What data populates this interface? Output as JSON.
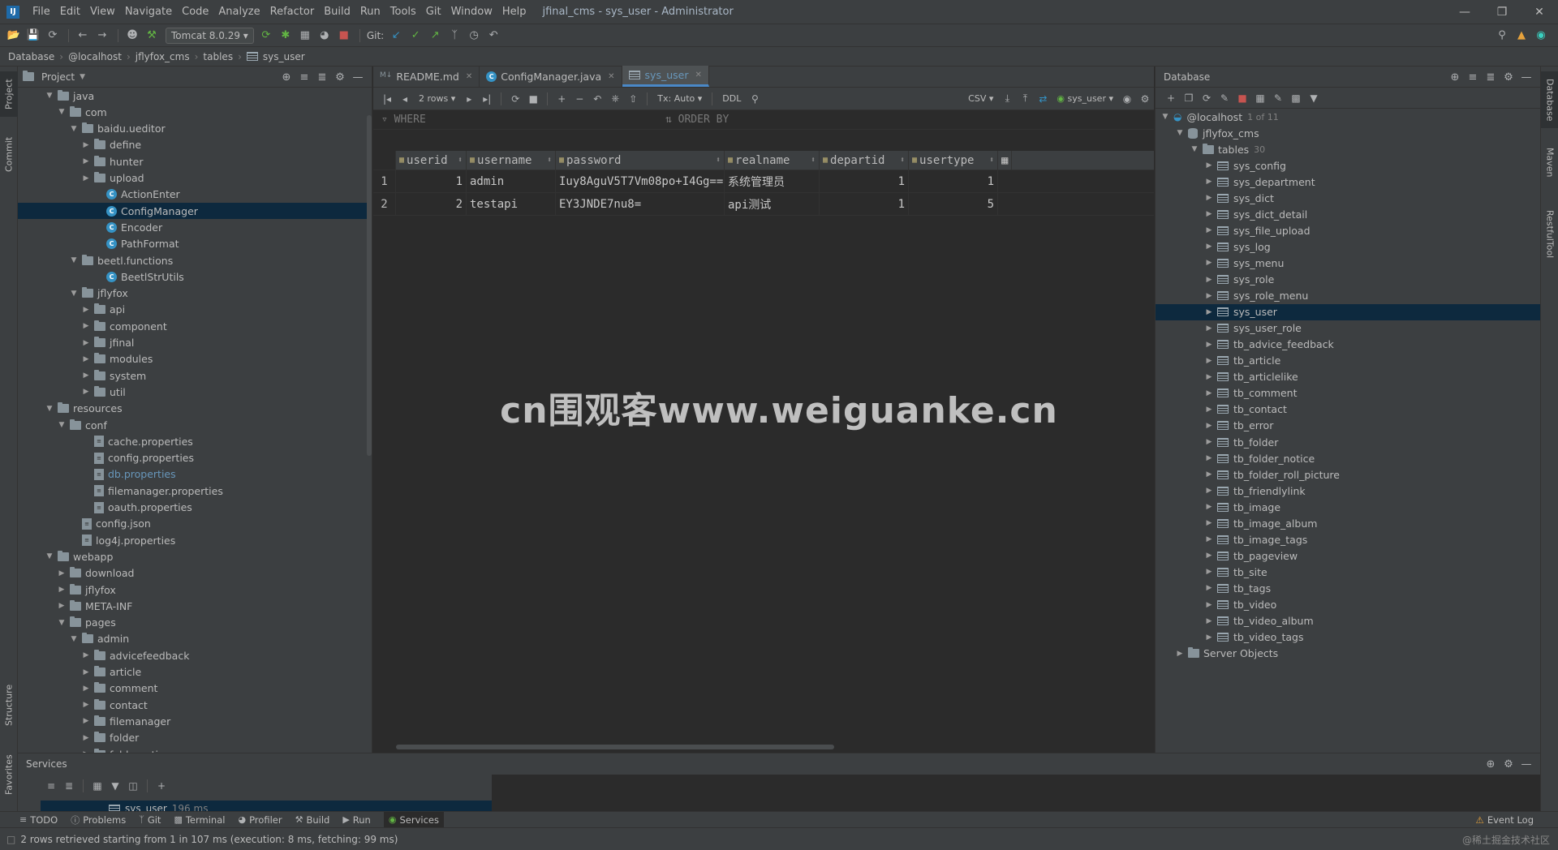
{
  "menu": [
    "File",
    "Edit",
    "View",
    "Navigate",
    "Code",
    "Analyze",
    "Refactor",
    "Build",
    "Run",
    "Tools",
    "Git",
    "Window",
    "Help"
  ],
  "window_title": "jfinal_cms - sys_user - Administrator",
  "toolbar": {
    "run_config": "Tomcat 8.0.29",
    "git_label": "Git:"
  },
  "breadcrumbs": [
    "Database",
    "@localhost",
    "jflyfox_cms",
    "tables",
    "sys_user"
  ],
  "left_strip": [
    "Project",
    "Commit",
    "Structure",
    "Favorites"
  ],
  "right_strip": [
    "Database",
    "Maven",
    "RestfulTool"
  ],
  "project": {
    "title": "Project",
    "tree": [
      {
        "label": "java",
        "depth": 3,
        "type": "folder",
        "open": true
      },
      {
        "label": "com",
        "depth": 4,
        "type": "folder",
        "open": true
      },
      {
        "label": "baidu.ueditor",
        "depth": 5,
        "type": "folder",
        "open": true
      },
      {
        "label": "define",
        "depth": 6,
        "type": "folder",
        "open": false
      },
      {
        "label": "hunter",
        "depth": 6,
        "type": "folder",
        "open": false
      },
      {
        "label": "upload",
        "depth": 6,
        "type": "folder",
        "open": false
      },
      {
        "label": "ActionEnter",
        "depth": 7,
        "type": "class"
      },
      {
        "label": "ConfigManager",
        "depth": 7,
        "type": "class",
        "selected": true
      },
      {
        "label": "Encoder",
        "depth": 7,
        "type": "class"
      },
      {
        "label": "PathFormat",
        "depth": 7,
        "type": "class"
      },
      {
        "label": "beetl.functions",
        "depth": 5,
        "type": "folder",
        "open": true
      },
      {
        "label": "BeetlStrUtils",
        "depth": 7,
        "type": "class"
      },
      {
        "label": "jflyfox",
        "depth": 5,
        "type": "folder",
        "open": true
      },
      {
        "label": "api",
        "depth": 6,
        "type": "folder",
        "open": false
      },
      {
        "label": "component",
        "depth": 6,
        "type": "folder",
        "open": false
      },
      {
        "label": "jfinal",
        "depth": 6,
        "type": "folder",
        "open": false
      },
      {
        "label": "modules",
        "depth": 6,
        "type": "folder",
        "open": false
      },
      {
        "label": "system",
        "depth": 6,
        "type": "folder",
        "open": false
      },
      {
        "label": "util",
        "depth": 6,
        "type": "folder",
        "open": false
      },
      {
        "label": "resources",
        "depth": 3,
        "type": "folder",
        "open": true
      },
      {
        "label": "conf",
        "depth": 4,
        "type": "folder",
        "open": true
      },
      {
        "label": "cache.properties",
        "depth": 6,
        "type": "prop"
      },
      {
        "label": "config.properties",
        "depth": 6,
        "type": "prop"
      },
      {
        "label": "db.properties",
        "depth": 6,
        "type": "prop",
        "blue": true
      },
      {
        "label": "filemanager.properties",
        "depth": 6,
        "type": "prop"
      },
      {
        "label": "oauth.properties",
        "depth": 6,
        "type": "prop"
      },
      {
        "label": "config.json",
        "depth": 5,
        "type": "prop"
      },
      {
        "label": "log4j.properties",
        "depth": 5,
        "type": "prop"
      },
      {
        "label": "webapp",
        "depth": 3,
        "type": "folder",
        "open": true
      },
      {
        "label": "download",
        "depth": 4,
        "type": "folder",
        "open": false
      },
      {
        "label": "jflyfox",
        "depth": 4,
        "type": "folder",
        "open": false
      },
      {
        "label": "META-INF",
        "depth": 4,
        "type": "folder",
        "open": false
      },
      {
        "label": "pages",
        "depth": 4,
        "type": "folder",
        "open": true
      },
      {
        "label": "admin",
        "depth": 5,
        "type": "folder",
        "open": true
      },
      {
        "label": "advicefeedback",
        "depth": 6,
        "type": "folder",
        "open": false
      },
      {
        "label": "article",
        "depth": 6,
        "type": "folder",
        "open": false
      },
      {
        "label": "comment",
        "depth": 6,
        "type": "folder",
        "open": false
      },
      {
        "label": "contact",
        "depth": 6,
        "type": "folder",
        "open": false
      },
      {
        "label": "filemanager",
        "depth": 6,
        "type": "folder",
        "open": false
      },
      {
        "label": "folder",
        "depth": 6,
        "type": "folder",
        "open": false
      },
      {
        "label": "foldernotice",
        "depth": 6,
        "type": "folder",
        "open": false
      }
    ]
  },
  "editor": {
    "tabs": [
      {
        "label": "README.md",
        "active": false
      },
      {
        "label": "ConfigManager.java",
        "active": false
      },
      {
        "label": "sys_user",
        "active": true
      }
    ],
    "grid_toolbar": {
      "rows": "2 rows",
      "tx": "Tx: Auto",
      "ddl": "DDL",
      "export": "CSV",
      "datasource": "sys_user"
    },
    "filter": {
      "where": "WHERE",
      "order_by": "ORDER BY"
    },
    "columns": [
      "userid",
      "username",
      "password",
      "realname",
      "departid",
      "usertype"
    ],
    "rows": [
      [
        "1",
        "1",
        "admin",
        "Iuy8AguV5T7Vm08po+I4Gg==",
        "系统管理员",
        "1",
        "1"
      ],
      [
        "2",
        "2",
        "testapi",
        "EY3JNDE7nu8=",
        "api测试",
        "1",
        "5"
      ]
    ]
  },
  "watermark": "cn围观客www.weiguanke.cn",
  "database": {
    "title": "Database",
    "host": "@localhost",
    "host_count": "1 of 11",
    "schema": "jflyfox_cms",
    "tables_label": "tables",
    "tables_count": "30",
    "tables": [
      "sys_config",
      "sys_department",
      "sys_dict",
      "sys_dict_detail",
      "sys_file_upload",
      "sys_log",
      "sys_menu",
      "sys_role",
      "sys_role_menu",
      "sys_user",
      "sys_user_role",
      "tb_advice_feedback",
      "tb_article",
      "tb_articlelike",
      "tb_comment",
      "tb_contact",
      "tb_error",
      "tb_folder",
      "tb_folder_notice",
      "tb_folder_roll_picture",
      "tb_friendlylink",
      "tb_image",
      "tb_image_album",
      "tb_image_tags",
      "tb_pageview",
      "tb_site",
      "tb_tags",
      "tb_video",
      "tb_video_album",
      "tb_video_tags"
    ],
    "selected_table": "sys_user",
    "server_objects": "Server Objects"
  },
  "services": {
    "title": "Services",
    "item": "sys_user",
    "item_time": "196 ms"
  },
  "bottom_tabs": [
    "TODO",
    "Problems",
    "Git",
    "Terminal",
    "Profiler",
    "Build",
    "Run",
    "Services"
  ],
  "event_log": "Event Log",
  "status": "2 rows retrieved starting from 1 in 107 ms (execution: 8 ms, fetching: 99 ms)",
  "status_right": "@稀土掘金技术社区"
}
